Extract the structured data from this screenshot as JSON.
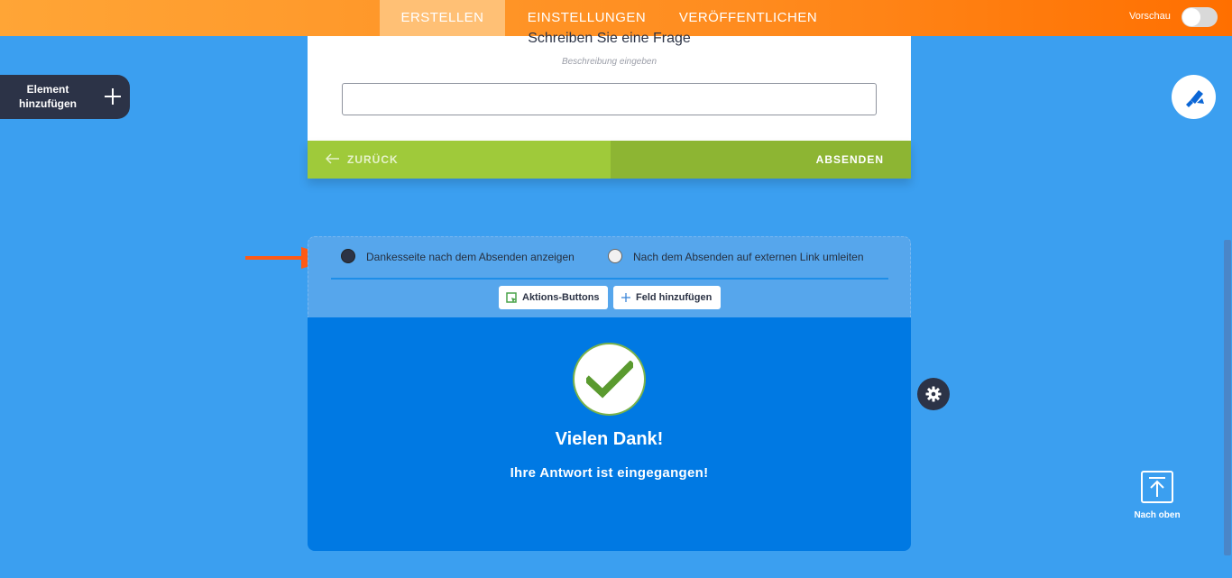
{
  "header": {
    "tabs": [
      {
        "label": "ERSTELLEN",
        "active": true
      },
      {
        "label": "EINSTELLUNGEN",
        "active": false
      },
      {
        "label": "VERÖFFENTLICHEN",
        "active": false
      }
    ],
    "preview_label": "Vorschau",
    "preview_on": false
  },
  "sidebar": {
    "add_element_label": "Element hinzufügen"
  },
  "form": {
    "question_title": "Schreiben Sie eine Frage",
    "question_description": "Beschreibung eingeben",
    "answer_value": "",
    "back_label": "ZURÜCK",
    "submit_label": "ABSENDEN"
  },
  "thank_you": {
    "option_show_page": "Dankesseite nach dem Absenden anzeigen",
    "option_redirect": "Nach dem Absenden auf externen Link umleiten",
    "selected_option": "show_page",
    "action_buttons_label": "Aktions-Buttons",
    "add_field_label": "Feld hinzufügen",
    "title": "Vielen Dank!",
    "subtitle": "Ihre Antwort ist eingegangen!"
  },
  "scroll_top_label": "Nach oben",
  "colors": {
    "header_orange": "#ff8c1f",
    "canvas_blue": "#3b9ff0",
    "thank_you_blue": "#0079e3",
    "button_green": "#9fca3a",
    "accent_arrow": "#ff5a14"
  },
  "icons": [
    "plus-icon",
    "paint-roller-icon",
    "arrow-left-icon",
    "checkmark-icon",
    "gear-icon",
    "action-buttons-icon",
    "arrow-up-icon"
  ]
}
